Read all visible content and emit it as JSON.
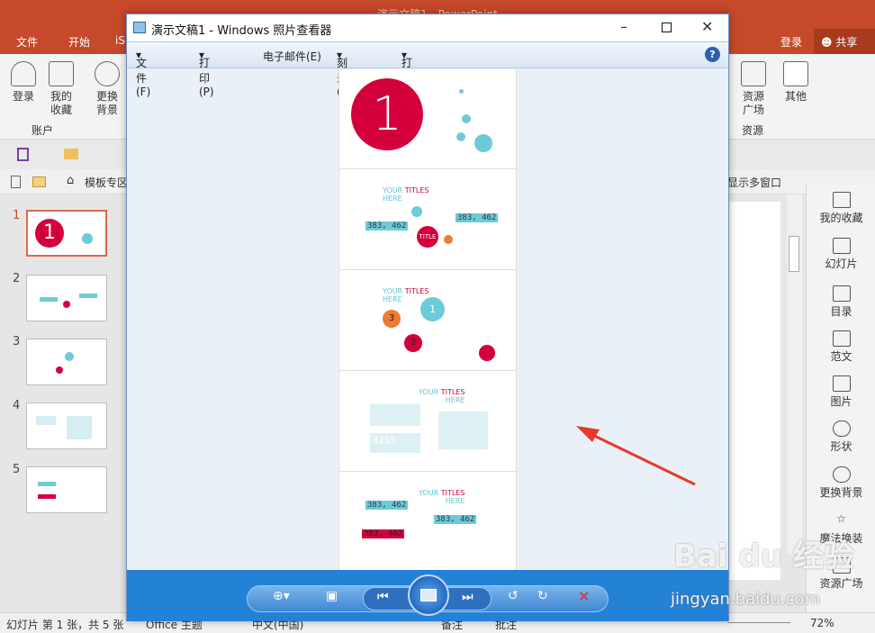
{
  "ppt": {
    "title": "演示文稿1 - PowerPoint",
    "tabs": [
      "文件",
      "开始",
      "iS"
    ],
    "login": "登录",
    "share": "共享",
    "ribbon": {
      "login": "登录",
      "favorites": "我的\n收藏",
      "change_bg": "更换\n背景",
      "group_account": "账户",
      "resource_square": "资源\n广场",
      "group_resource": "资源",
      "other": "其他"
    },
    "toolbar2": {
      "template_zone": "模板专区",
      "multi_window": "显示多窗口"
    },
    "slide_numbers": [
      "1",
      "2",
      "3",
      "4",
      "5"
    ],
    "right_pane": [
      "我的收藏",
      "幻灯片",
      "目录",
      "范文",
      "图片",
      "形状",
      "更换背景",
      "魔法换装",
      "资源广场"
    ],
    "status": {
      "slide_info": "幻灯片 第 1 张，共 5 张",
      "theme": "Office 主题",
      "language": "中文(中国)",
      "notes": "备注",
      "comments": "批注",
      "zoom": "72%"
    }
  },
  "viewer": {
    "title": "演示文稿1 - Windows 照片查看器",
    "menu": [
      "文件(F)",
      "打印(P)",
      "电子邮件(E)",
      "刻录(U)",
      "打开(O)"
    ],
    "slides": {
      "big_number": "1",
      "your": "YOUR",
      "titles": "TITLES",
      "here": "HERE",
      "value": "383, 462",
      "title_circle": "TITLE",
      "n1": "1",
      "n2": "2",
      "n3": "3",
      "value2": "4235"
    }
  },
  "watermark": {
    "brand": "Bai du 经验",
    "url": "jingyan.baidu.com"
  },
  "colors": {
    "ppt_orange": "#c5492a",
    "viewer_blue": "#2381d6",
    "accent_red": "#d4003c",
    "accent_cyan": "#5cc3d4"
  }
}
